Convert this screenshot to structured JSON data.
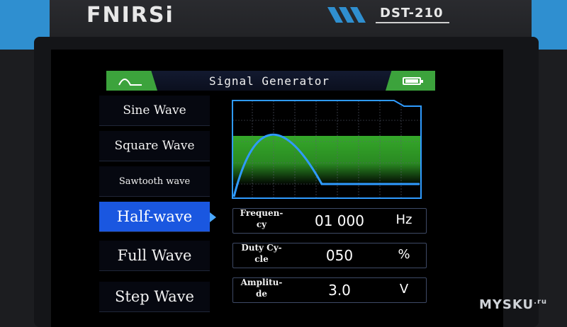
{
  "device": {
    "brand": "FNIRSi",
    "model": "DST-210"
  },
  "header": {
    "title": "Signal Generator",
    "left_icon": "half-wave-icon",
    "right_icon": "battery-icon"
  },
  "menu": {
    "items": [
      {
        "label": "Sine Wave",
        "active": false
      },
      {
        "label": "Square Wave",
        "active": false
      },
      {
        "label": "Sawtooth wave",
        "active": false
      },
      {
        "label": "Half-wave",
        "active": true
      },
      {
        "label": "Full Wave",
        "active": false
      },
      {
        "label": "Step Wave",
        "active": false
      }
    ]
  },
  "params": [
    {
      "label": "Frequen-\ncy",
      "value": "01 000",
      "unit": "Hz"
    },
    {
      "label": "Duty Cy-\ncle",
      "value": "050",
      "unit": "%"
    },
    {
      "label": "Amplitu-\nde",
      "value": "3.0",
      "unit": "V"
    }
  ],
  "watermark": {
    "text": "MYSKU",
    "suffix": ".ru"
  },
  "colors": {
    "accent_green": "#3ca33c",
    "waveform_blue": "#2f9bff",
    "selection_blue": "#1a57e0",
    "device_blue": "#2f8fd0"
  }
}
